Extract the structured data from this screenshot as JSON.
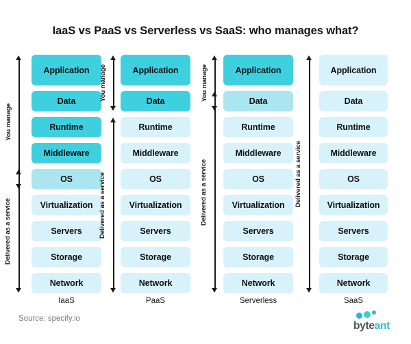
{
  "title": "IaaS vs PaaS vs Serverless vs SaaS: who manages what?",
  "source_note": "Source: specify.io",
  "logo": {
    "word_primary": "byte",
    "word_accent": "ant",
    "dot_icon_name": "three-dots-icon",
    "primary_color": "#4a4f55",
    "accent_color": "#2fc0d6"
  },
  "palette": {
    "managed_by_you": "#3fd0e0",
    "shared": "#abe5ef",
    "delivered_as_service": "#d8f2fb",
    "arrow": "#1a1a1a",
    "background": "#ffffff"
  },
  "arrow_labels": {
    "you_manage": "You manage",
    "delivered": "Delivered as a service"
  },
  "chart_data": {
    "type": "table",
    "title": "IaaS vs PaaS vs Serverless vs SaaS: who manages what?",
    "xlabel": "",
    "ylabel": "",
    "legend": [
      "You manage",
      "Delivered as a service"
    ],
    "layers": [
      "Application",
      "Data",
      "Runtime",
      "Middleware",
      "OS",
      "Virtualization",
      "Servers",
      "Storage",
      "Network"
    ],
    "categories": [
      "IaaS",
      "PaaS",
      "Serverless",
      "SaaS"
    ],
    "series": [
      {
        "name": "IaaS",
        "values": [
          "you-manage",
          "you-manage",
          "you-manage",
          "you-manage",
          "shared",
          "delivered",
          "delivered",
          "delivered",
          "delivered"
        ],
        "you_manage_span": [
          "Application",
          "OS"
        ],
        "delivered_span": [
          "OS",
          "Network"
        ]
      },
      {
        "name": "PaaS",
        "values": [
          "you-manage",
          "you-manage",
          "delivered",
          "delivered",
          "delivered",
          "delivered",
          "delivered",
          "delivered",
          "delivered"
        ],
        "you_manage_span": [
          "Application",
          "Data"
        ],
        "delivered_span": [
          "Runtime",
          "Network"
        ]
      },
      {
        "name": "Serverless",
        "values": [
          "you-manage",
          "shared",
          "delivered",
          "delivered",
          "delivered",
          "delivered",
          "delivered",
          "delivered",
          "delivered"
        ],
        "you_manage_span": [
          "Application",
          "Data"
        ],
        "delivered_span": [
          "Data",
          "Network"
        ]
      },
      {
        "name": "SaaS",
        "values": [
          "delivered",
          "delivered",
          "delivered",
          "delivered",
          "delivered",
          "delivered",
          "delivered",
          "delivered",
          "delivered"
        ],
        "you_manage_span": [],
        "delivered_span": [
          "Application",
          "Network"
        ]
      }
    ]
  },
  "columns": [
    {
      "id": "iaas",
      "label": "IaaS",
      "layers": [
        {
          "name": "Application",
          "tone": "dark"
        },
        {
          "name": "Data",
          "tone": "dark"
        },
        {
          "name": "Runtime",
          "tone": "dark"
        },
        {
          "name": "Middleware",
          "tone": "dark"
        },
        {
          "name": "OS",
          "tone": "mid"
        },
        {
          "name": "Virtualization",
          "tone": "light"
        },
        {
          "name": "Servers",
          "tone": "light"
        },
        {
          "name": "Storage",
          "tone": "light"
        },
        {
          "name": "Network",
          "tone": "light"
        }
      ]
    },
    {
      "id": "paas",
      "label": "PaaS",
      "layers": [
        {
          "name": "Application",
          "tone": "dark"
        },
        {
          "name": "Data",
          "tone": "dark"
        },
        {
          "name": "Runtime",
          "tone": "light"
        },
        {
          "name": "Middleware",
          "tone": "light"
        },
        {
          "name": "OS",
          "tone": "light"
        },
        {
          "name": "Virtualization",
          "tone": "light"
        },
        {
          "name": "Servers",
          "tone": "light"
        },
        {
          "name": "Storage",
          "tone": "light"
        },
        {
          "name": "Network",
          "tone": "light"
        }
      ]
    },
    {
      "id": "serverless",
      "label": "Serverless",
      "layers": [
        {
          "name": "Application",
          "tone": "dark"
        },
        {
          "name": "Data",
          "tone": "mid"
        },
        {
          "name": "Runtime",
          "tone": "light"
        },
        {
          "name": "Middleware",
          "tone": "light"
        },
        {
          "name": "OS",
          "tone": "light"
        },
        {
          "name": "Virtualization",
          "tone": "light"
        },
        {
          "name": "Servers",
          "tone": "light"
        },
        {
          "name": "Storage",
          "tone": "light"
        },
        {
          "name": "Network",
          "tone": "light"
        }
      ]
    },
    {
      "id": "saas",
      "label": "SaaS",
      "layers": [
        {
          "name": "Application",
          "tone": "light"
        },
        {
          "name": "Data",
          "tone": "light"
        },
        {
          "name": "Runtime",
          "tone": "light"
        },
        {
          "name": "Middleware",
          "tone": "light"
        },
        {
          "name": "OS",
          "tone": "light"
        },
        {
          "name": "Virtualization",
          "tone": "light"
        },
        {
          "name": "Servers",
          "tone": "light"
        },
        {
          "name": "Storage",
          "tone": "light"
        },
        {
          "name": "Network",
          "tone": "light"
        }
      ]
    }
  ]
}
